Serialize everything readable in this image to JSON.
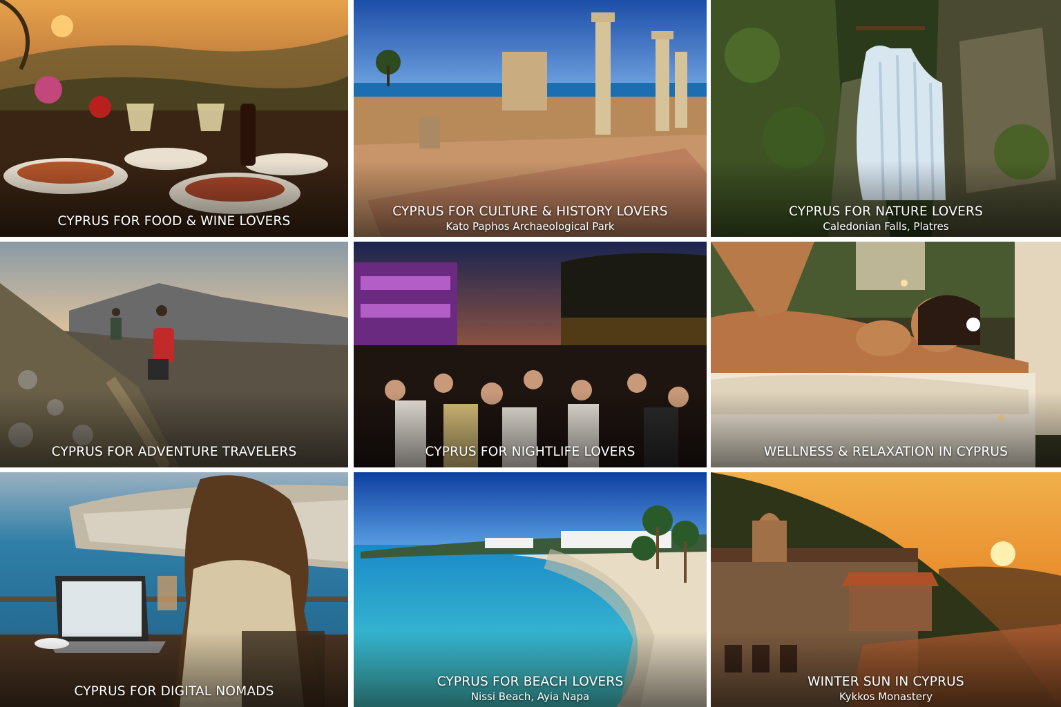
{
  "tiles": [
    {
      "title": "CYPRUS FOR FOOD & WINE LOVERS",
      "subtitle": ""
    },
    {
      "title": "CYPRUS FOR CULTURE & HISTORY LOVERS",
      "subtitle": "Kato Paphos Archaeological Park"
    },
    {
      "title": "CYPRUS FOR NATURE LOVERS",
      "subtitle": "Caledonian Falls, Platres"
    },
    {
      "title": "CYPRUS FOR ADVENTURE TRAVELERS",
      "subtitle": ""
    },
    {
      "title": "CYPRUS FOR NIGHTLIFE LOVERS",
      "subtitle": ""
    },
    {
      "title": "WELLNESS & RELAXATION IN CYPRUS",
      "subtitle": ""
    },
    {
      "title": "CYPRUS FOR DIGITAL NOMADS",
      "subtitle": ""
    },
    {
      "title": "CYPRUS FOR BEACH LOVERS",
      "subtitle": "Nissi Beach, Ayia Napa"
    },
    {
      "title": "WINTER SUN IN CYPRUS",
      "subtitle": "Kykkos Monastery"
    }
  ]
}
